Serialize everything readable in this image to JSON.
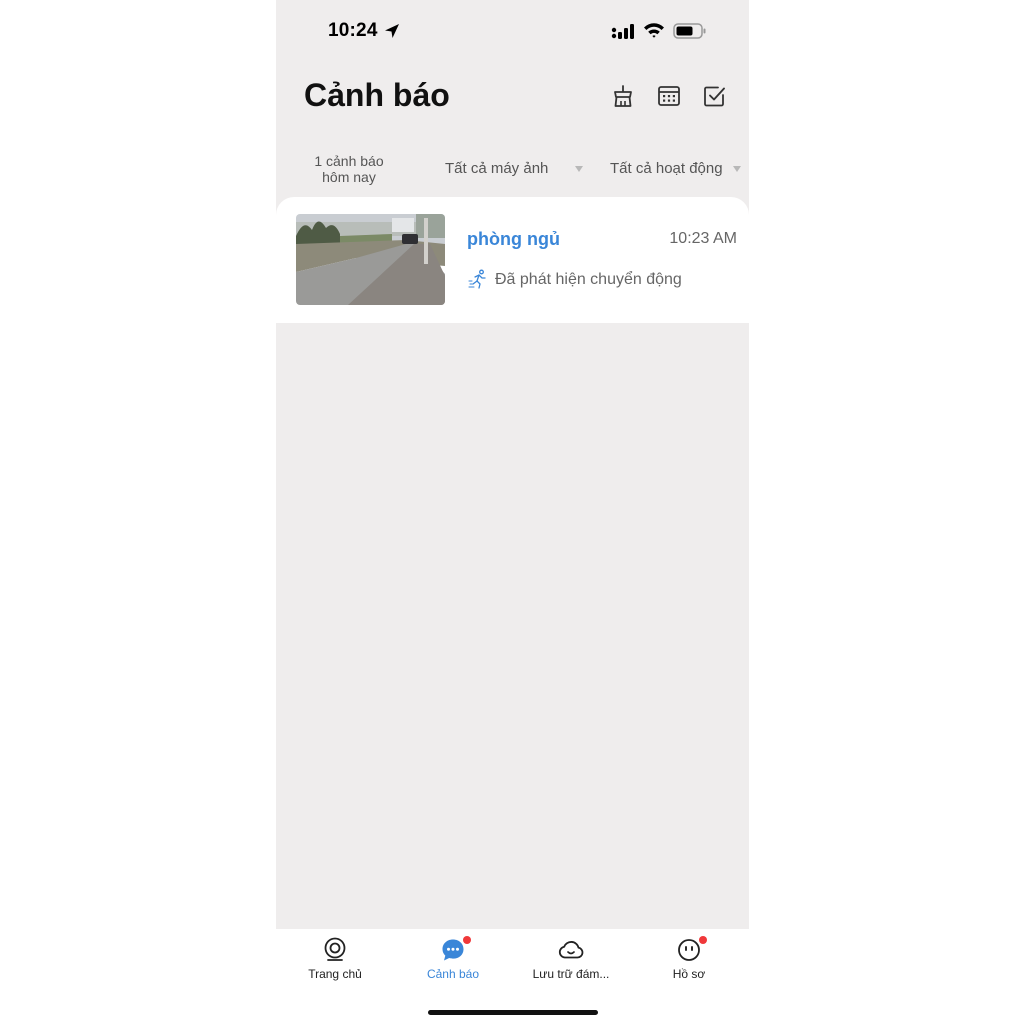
{
  "status_bar": {
    "time": "10:24",
    "icons": [
      "location-arrow-icon",
      "cellular-signal-icon",
      "wifi-icon",
      "battery-icon"
    ]
  },
  "header": {
    "title": "Cảnh báo",
    "actions": [
      "clean-brush-icon",
      "calendar-icon",
      "checkbox-select-icon"
    ]
  },
  "filters": {
    "today_count_line1": "1 cảnh báo",
    "today_count_line2": "hôm nay",
    "camera": "Tất cả máy ảnh",
    "activity": "Tất cả hoạt động"
  },
  "alerts": [
    {
      "camera_name": "phòng ngủ",
      "time": "10:23 AM",
      "event_icon": "running-person-motion-icon",
      "description": "Đã phát hiện chuyển động"
    }
  ],
  "bottom_nav": {
    "items": [
      {
        "label": "Trang chủ",
        "icon": "camera-lens-icon",
        "badge": false
      },
      {
        "label": "Cảnh báo",
        "icon": "chat-bubble-icon",
        "badge": true,
        "active": true
      },
      {
        "label": "Lưu trữ đám...",
        "icon": "cloud-icon",
        "badge": false
      },
      {
        "label": "Hồ sơ",
        "icon": "smiley-face-icon",
        "badge": true
      }
    ]
  },
  "colors": {
    "accent": "#3a86d8",
    "background": "#efeded",
    "badge": "#f0383a"
  }
}
